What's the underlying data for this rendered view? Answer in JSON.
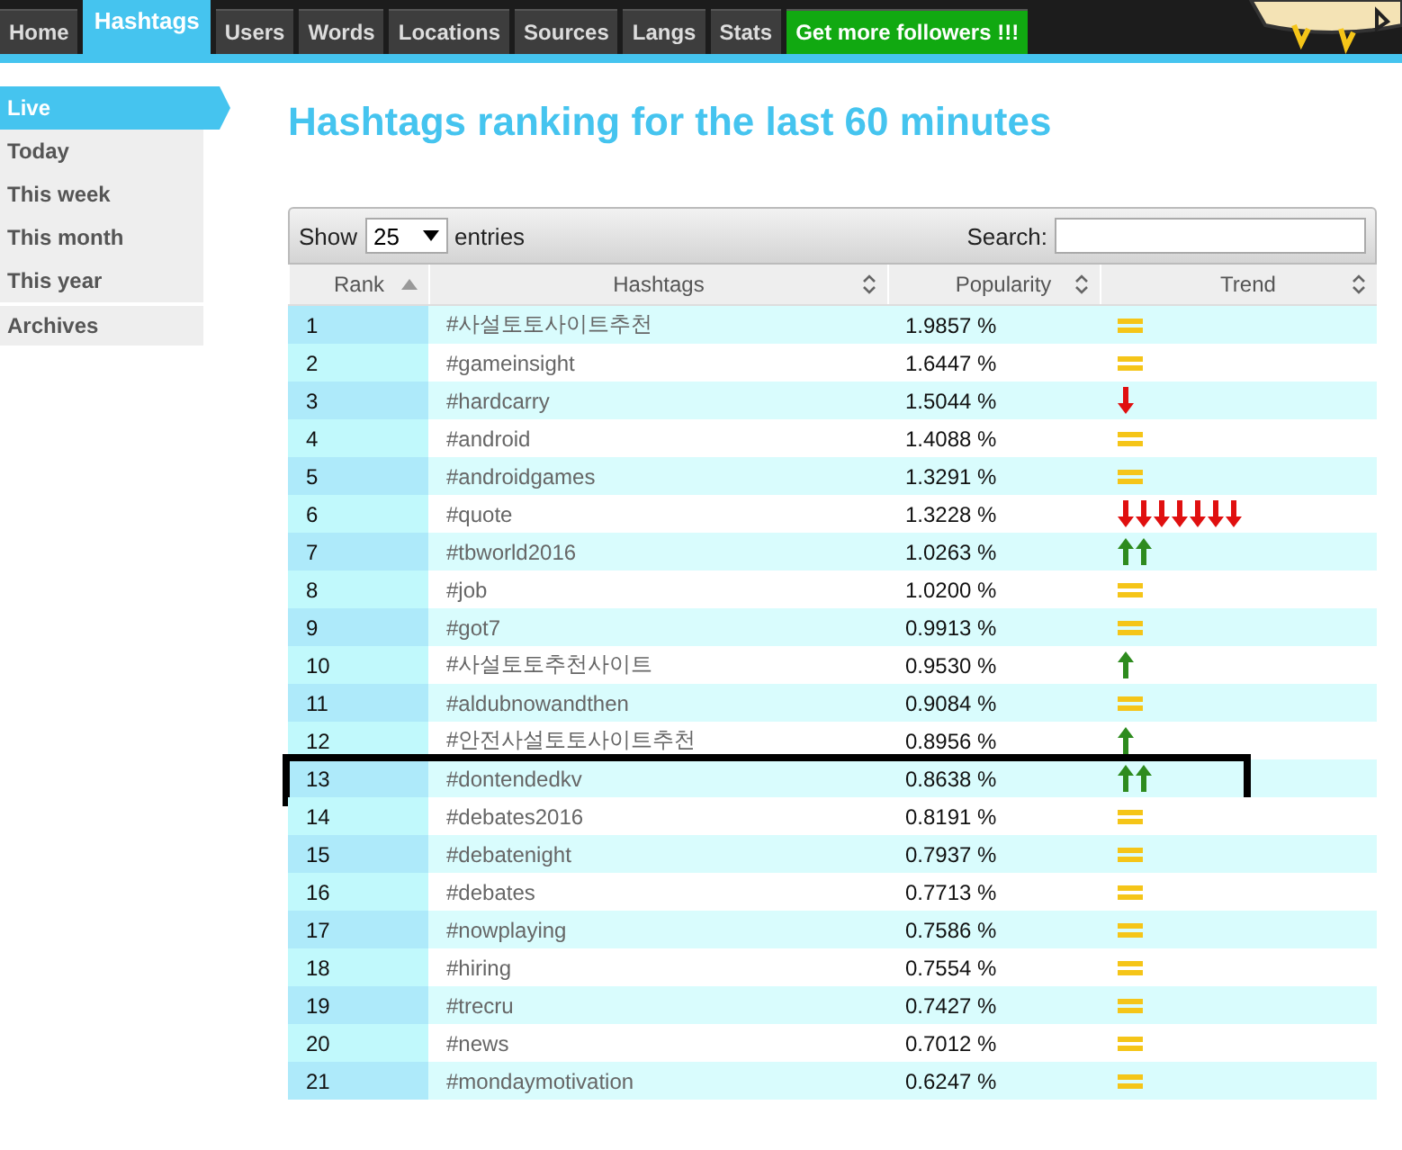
{
  "nav": {
    "tabs": [
      {
        "label": "Home",
        "selected": false,
        "kind": "tab"
      },
      {
        "label": "Hashtags",
        "selected": true,
        "kind": "tab"
      },
      {
        "label": "Users",
        "selected": false,
        "kind": "tab"
      },
      {
        "label": "Words",
        "selected": false,
        "kind": "tab"
      },
      {
        "label": "Locations",
        "selected": false,
        "kind": "tab"
      },
      {
        "label": "Sources",
        "selected": false,
        "kind": "tab"
      },
      {
        "label": "Langs",
        "selected": false,
        "kind": "tab"
      },
      {
        "label": "Stats",
        "selected": false,
        "kind": "tab"
      },
      {
        "label": "Get more followers !!!",
        "selected": false,
        "kind": "promo"
      }
    ]
  },
  "sidebar": {
    "items": [
      {
        "label": "Live",
        "selected": true
      },
      {
        "label": "Today",
        "selected": false
      },
      {
        "label": "This week",
        "selected": false
      },
      {
        "label": "This month",
        "selected": false
      },
      {
        "label": "This year",
        "selected": false
      }
    ],
    "archives": "Archives"
  },
  "title": "Hashtags ranking for the last 60 minutes",
  "table": {
    "show_label": "Show",
    "page_size": "25",
    "entries_label": "entries",
    "search_label": "Search:",
    "columns": [
      {
        "label": "Rank",
        "sorted": true
      },
      {
        "label": "Hashtags",
        "sorted": false
      },
      {
        "label": "Popularity",
        "sorted": false
      },
      {
        "label": "Trend",
        "sorted": false
      }
    ],
    "rows": [
      {
        "rank": "1",
        "hashtag": "#사설토토사이트추천",
        "popularity": "1.9857 %",
        "trend": [
          {
            "kind": "same"
          }
        ],
        "highlighted": false
      },
      {
        "rank": "2",
        "hashtag": "#gameinsight",
        "popularity": "1.6447 %",
        "trend": [
          {
            "kind": "same"
          }
        ],
        "highlighted": false
      },
      {
        "rank": "3",
        "hashtag": "#hardcarry",
        "popularity": "1.5044 %",
        "trend": [
          {
            "kind": "down"
          }
        ],
        "highlighted": false
      },
      {
        "rank": "4",
        "hashtag": "#android",
        "popularity": "1.4088 %",
        "trend": [
          {
            "kind": "same"
          }
        ],
        "highlighted": false
      },
      {
        "rank": "5",
        "hashtag": "#androidgames",
        "popularity": "1.3291 %",
        "trend": [
          {
            "kind": "same"
          }
        ],
        "highlighted": false
      },
      {
        "rank": "6",
        "hashtag": "#quote",
        "popularity": "1.3228 %",
        "trend": [
          {
            "kind": "down"
          },
          {
            "kind": "down"
          },
          {
            "kind": "down"
          },
          {
            "kind": "down"
          },
          {
            "kind": "down"
          },
          {
            "kind": "down"
          },
          {
            "kind": "down"
          }
        ],
        "highlighted": false
      },
      {
        "rank": "7",
        "hashtag": "#tbworld2016",
        "popularity": "1.0263 %",
        "trend": [
          {
            "kind": "up"
          },
          {
            "kind": "up"
          }
        ],
        "highlighted": false
      },
      {
        "rank": "8",
        "hashtag": "#job",
        "popularity": "1.0200 %",
        "trend": [
          {
            "kind": "same"
          }
        ],
        "highlighted": false
      },
      {
        "rank": "9",
        "hashtag": "#got7",
        "popularity": "0.9913 %",
        "trend": [
          {
            "kind": "same"
          }
        ],
        "highlighted": false
      },
      {
        "rank": "10",
        "hashtag": "#사설토토추천사이트",
        "popularity": "0.9530 %",
        "trend": [
          {
            "kind": "up"
          }
        ],
        "highlighted": false
      },
      {
        "rank": "11",
        "hashtag": "#aldubnowandthen",
        "popularity": "0.9084 %",
        "trend": [
          {
            "kind": "same"
          }
        ],
        "highlighted": false
      },
      {
        "rank": "12",
        "hashtag": "#안전사설토토사이트추천",
        "popularity": "0.8956 %",
        "trend": [
          {
            "kind": "up"
          }
        ],
        "highlighted": false
      },
      {
        "rank": "13",
        "hashtag": "#dontendedkv",
        "popularity": "0.8638 %",
        "trend": [
          {
            "kind": "up"
          },
          {
            "kind": "up"
          }
        ],
        "highlighted": true
      },
      {
        "rank": "14",
        "hashtag": "#debates2016",
        "popularity": "0.8191 %",
        "trend": [
          {
            "kind": "same"
          }
        ],
        "highlighted": false
      },
      {
        "rank": "15",
        "hashtag": "#debatenight",
        "popularity": "0.7937 %",
        "trend": [
          {
            "kind": "same"
          }
        ],
        "highlighted": false
      },
      {
        "rank": "16",
        "hashtag": "#debates",
        "popularity": "0.7713 %",
        "trend": [
          {
            "kind": "same"
          }
        ],
        "highlighted": false
      },
      {
        "rank": "17",
        "hashtag": "#nowplaying",
        "popularity": "0.7586 %",
        "trend": [
          {
            "kind": "same"
          }
        ],
        "highlighted": false
      },
      {
        "rank": "18",
        "hashtag": "#hiring",
        "popularity": "0.7554 %",
        "trend": [
          {
            "kind": "same"
          }
        ],
        "highlighted": false
      },
      {
        "rank": "19",
        "hashtag": "#trecru",
        "popularity": "0.7427 %",
        "trend": [
          {
            "kind": "same"
          }
        ],
        "highlighted": false
      },
      {
        "rank": "20",
        "hashtag": "#news",
        "popularity": "0.7012 %",
        "trend": [
          {
            "kind": "same"
          }
        ],
        "highlighted": false
      },
      {
        "rank": "21",
        "hashtag": "#mondaymotivation",
        "popularity": "0.6247 %",
        "trend": [
          {
            "kind": "same"
          }
        ],
        "highlighted": false
      }
    ]
  }
}
